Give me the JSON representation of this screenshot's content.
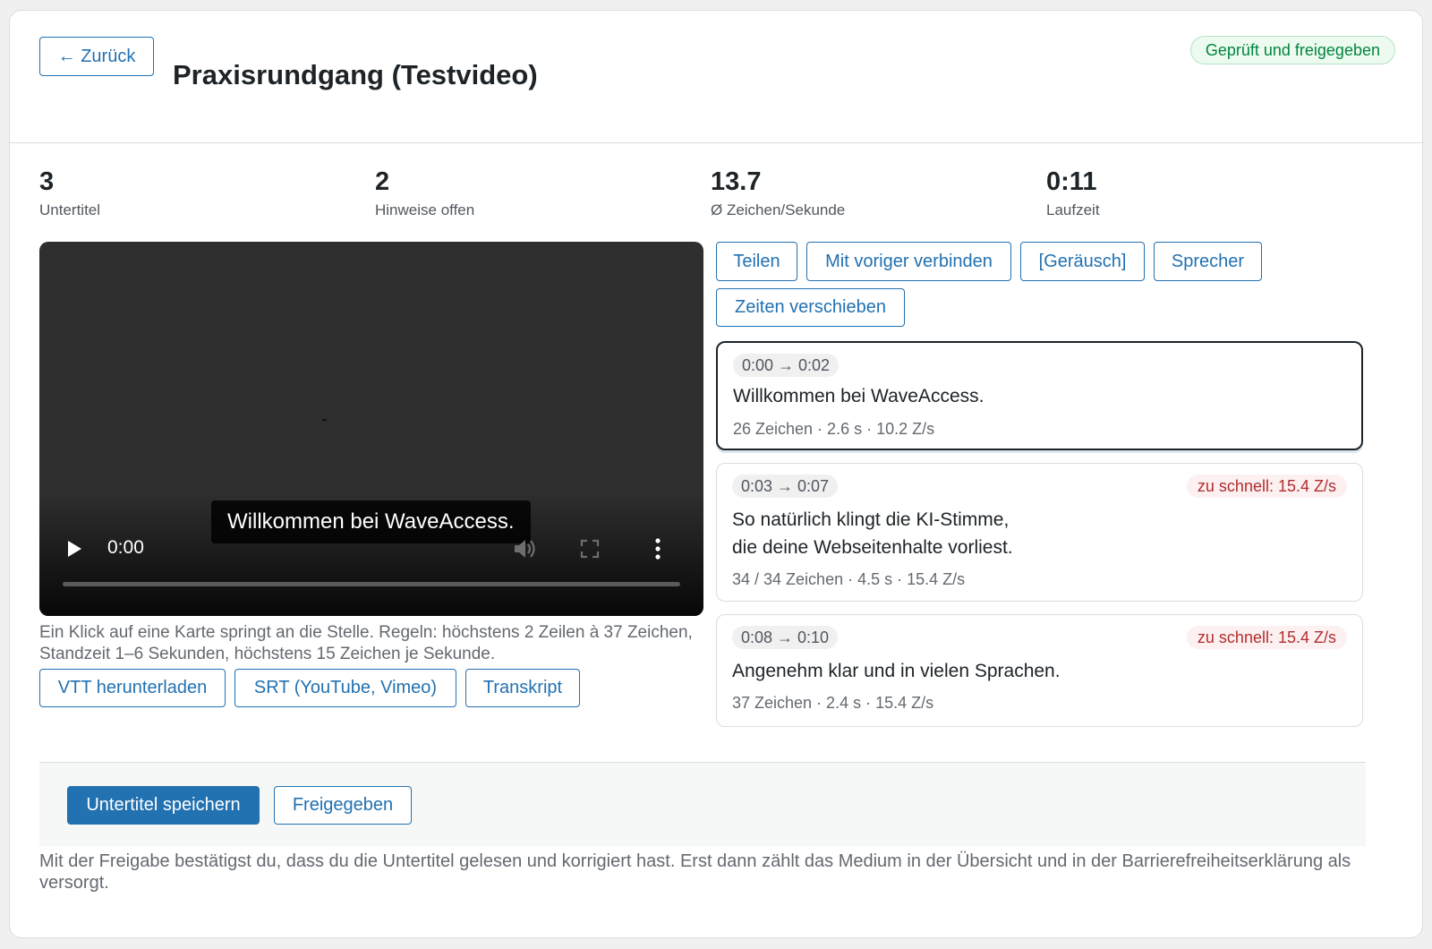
{
  "header": {
    "back_label": "← Zurück",
    "title": "Praxisrundgang (Testvideo)",
    "status_badge": "Geprüft und freigegeben"
  },
  "stats": [
    {
      "value": "3",
      "label": "Untertitel"
    },
    {
      "value": "2",
      "label": "Hinweise offen"
    },
    {
      "value": "13.7",
      "label": "Ø Zeichen/Sekunde"
    },
    {
      "value": "0:11",
      "label": "Laufzeit"
    }
  ],
  "player": {
    "caption": "Willkommen bei WaveAccess.",
    "current_time": "0:00",
    "progress": 0
  },
  "hint": "Ein Klick auf eine Karte springt an die Stelle. Regeln: höchstens 2 Zeilen à 37 Zeichen, Standzeit 1–6 Sekunden, höchstens 15 Zeichen je Sekunde.",
  "downloads": {
    "vtt": "VTT herunterladen",
    "srt": "SRT (YouTube, Vimeo)",
    "transcript": "Transkript"
  },
  "toolbar": {
    "split": "Teilen",
    "merge": "Mit voriger verbinden",
    "noise": "[Geräusch]",
    "speaker": "Sprecher",
    "shift": "Zeiten verschieben"
  },
  "subtitles": [
    {
      "time": "0:00 → 0:02",
      "lines": [
        "Willkommen bei WaveAccess."
      ],
      "meta": "26 Zeichen · 2.6 s · 10.2 Z/s",
      "warning": "",
      "active": true
    },
    {
      "time": "0:03 → 0:07",
      "lines": [
        "So natürlich klingt die KI-Stimme,",
        "die deine Webseitenhalte vorliest."
      ],
      "meta": "34 / 34 Zeichen · 4.5 s · 15.4 Z/s",
      "warning": "zu schnell: 15.4 Z/s",
      "active": false
    },
    {
      "time": "0:08 → 0:10",
      "lines": [
        "Angenehm klar und in vielen Sprachen."
      ],
      "meta": "37 Zeichen · 2.4 s · 15.4 Z/s",
      "warning": "zu schnell: 15.4 Z/s",
      "active": false
    }
  ],
  "footer": {
    "save": "Untertitel speichern",
    "release": "Freigegeben",
    "note": "Mit der Freigabe bestätigst du, dass du die Untertitel gelesen und korrigiert hast. Erst dann zählt das Medium in der Übersicht und in der Barrierefreiheitserklärung als versorgt."
  },
  "colors": {
    "accent": "#2271b1",
    "success": "#00863f",
    "warning": "#b32d2e"
  }
}
